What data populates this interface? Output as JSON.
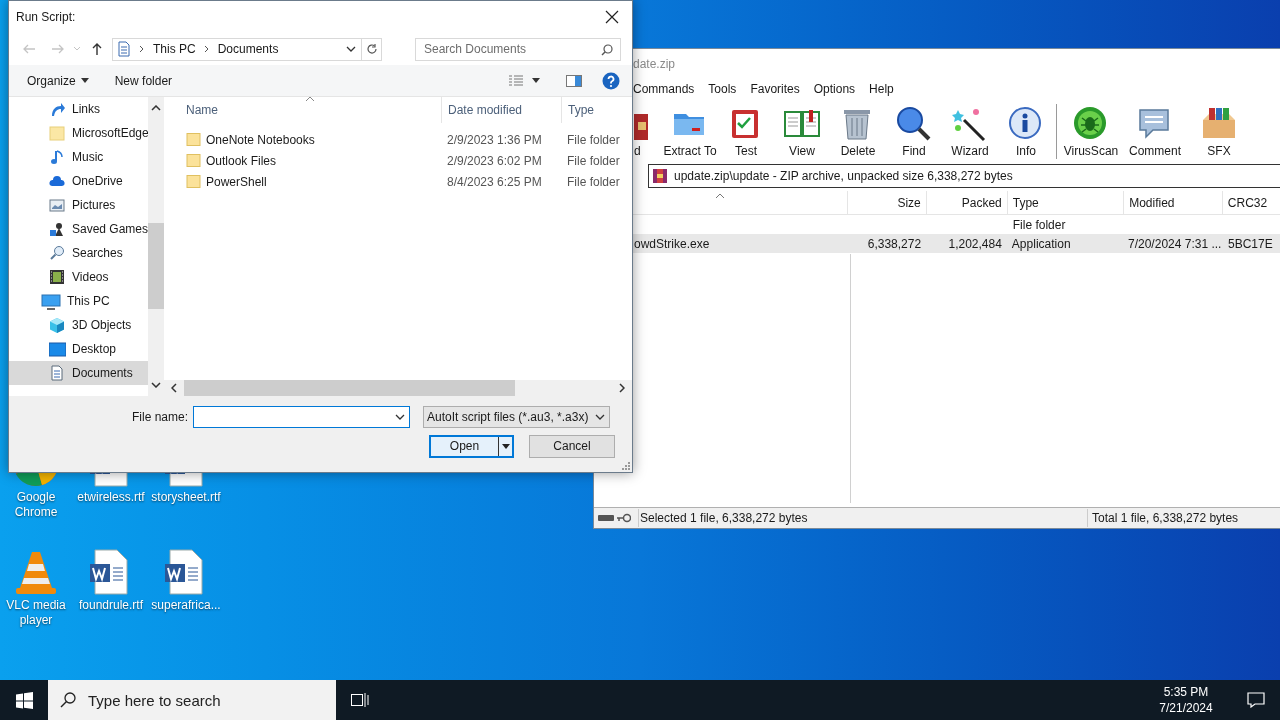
{
  "dialog": {
    "title": "Run Script:",
    "breadcrumb": [
      "This PC",
      "Documents"
    ],
    "search": {
      "placeholder": "Search Documents"
    },
    "toolbar": {
      "organize": "Organize",
      "new_folder": "New folder"
    },
    "nav_tree": [
      {
        "label": "Links",
        "kind": "link",
        "selected": false
      },
      {
        "label": "MicrosoftEdge",
        "kind": "folder",
        "selected": false
      },
      {
        "label": "Music",
        "kind": "music",
        "selected": false
      },
      {
        "label": "OneDrive",
        "kind": "cloud",
        "selected": false
      },
      {
        "label": "Pictures",
        "kind": "pictures",
        "selected": false
      },
      {
        "label": "Saved Games",
        "kind": "games",
        "selected": false
      },
      {
        "label": "Searches",
        "kind": "search",
        "selected": false
      },
      {
        "label": "Videos",
        "kind": "videos",
        "selected": false
      },
      {
        "label": "This PC",
        "kind": "pc",
        "selected": false,
        "children": [
          {
            "label": "3D Objects",
            "kind": "cube",
            "selected": false
          },
          {
            "label": "Desktop",
            "kind": "desktop",
            "selected": false
          },
          {
            "label": "Documents",
            "kind": "documents",
            "selected": true
          }
        ]
      }
    ],
    "columns": [
      "Name",
      "Date modified",
      "Type"
    ],
    "files": [
      {
        "name": "OneNote Notebooks",
        "date": "2/9/2023 1:36 PM",
        "type": "File folder"
      },
      {
        "name": "Outlook Files",
        "date": "2/9/2023 6:02 PM",
        "type": "File folder"
      },
      {
        "name": "PowerShell",
        "date": "8/4/2023 6:25 PM",
        "type": "File folder"
      }
    ],
    "file_name_label": "File name:",
    "file_type": "AutoIt script files (*.au3, *.a3x)",
    "buttons": {
      "open": "Open",
      "cancel": "Cancel"
    }
  },
  "archiver": {
    "title": "date.zip",
    "menu": [
      "Commands",
      "Tools",
      "Favorites",
      "Options",
      "Help"
    ],
    "toolbar_groups": [
      [
        {
          "label": "d",
          "kind": "add"
        },
        {
          "label": "Extract To",
          "kind": "extract"
        },
        {
          "label": "Test",
          "kind": "test"
        },
        {
          "label": "View",
          "kind": "view"
        },
        {
          "label": "Delete",
          "kind": "delete"
        },
        {
          "label": "Find",
          "kind": "find"
        },
        {
          "label": "Wizard",
          "kind": "wizard"
        },
        {
          "label": "Info",
          "kind": "info"
        }
      ],
      [
        {
          "label": "VirusScan",
          "kind": "virus"
        },
        {
          "label": "Comment",
          "kind": "comment"
        },
        {
          "label": "SFX",
          "kind": "sfx"
        }
      ]
    ],
    "path": "update.zip\\update - ZIP archive, unpacked size 6,338,272 bytes",
    "columns": [
      "Size",
      "Packed",
      "Type",
      "Modified",
      "CRC32"
    ],
    "rows": [
      {
        "type": "File folder",
        "selected": false
      },
      {
        "name": "owdStrike.exe",
        "size": "6,338,272",
        "packed": "1,202,484",
        "type": "Application",
        "modified": "7/20/2024 7:31 ...",
        "crc": "5BC17E",
        "selected": true
      }
    ],
    "status_left": "Selected 1 file, 6,338,272 bytes",
    "status_right": "Total 1 file, 6,338,272 bytes"
  },
  "desktop_icons": [
    {
      "label": "Google Chrome",
      "kind": "browser"
    },
    {
      "label": "etwireless.rtf",
      "kind": "doc"
    },
    {
      "label": "storysheet.rtf",
      "kind": "doc"
    },
    {
      "label": "VLC media player",
      "kind": "cone"
    },
    {
      "label": "foundrule.rtf",
      "kind": "doc"
    },
    {
      "label": "superafrica...",
      "kind": "doc"
    }
  ],
  "taskbar": {
    "search_placeholder": "Type here to search",
    "time": "5:35 PM",
    "date": "7/21/2024"
  }
}
